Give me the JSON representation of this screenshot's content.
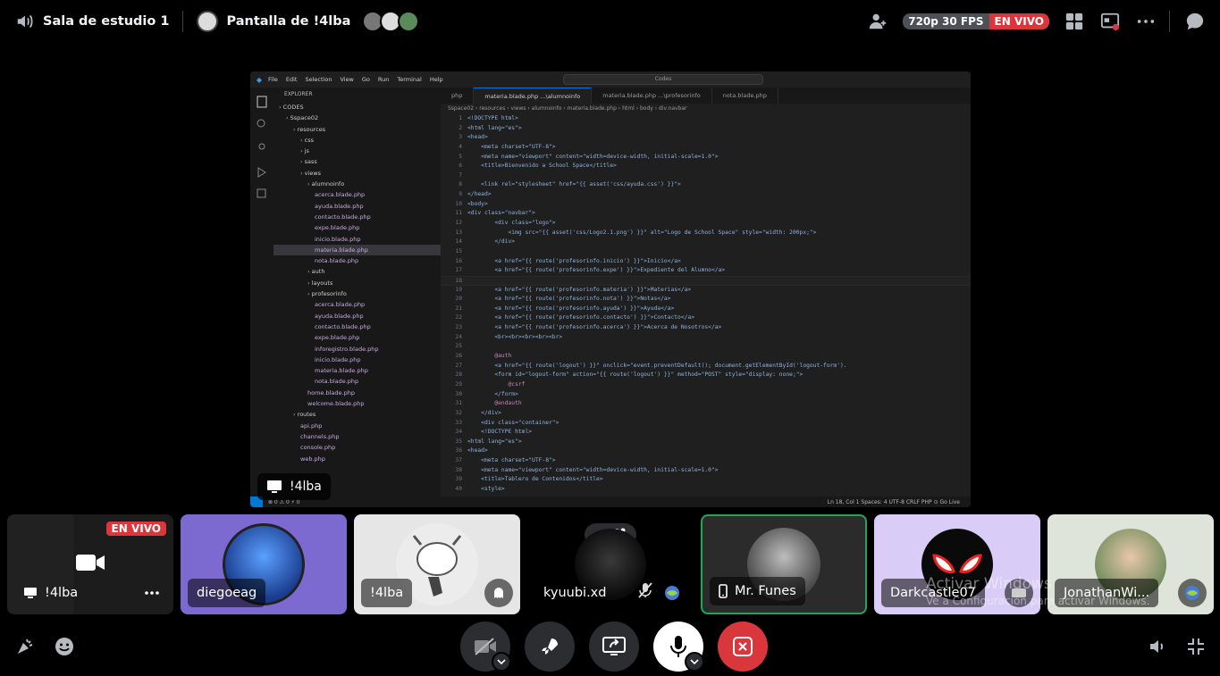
{
  "topbar": {
    "channel_name": "Sala de estudio 1",
    "stream_title": "Pantalla de !4lba",
    "quality": "720p 30 FPS",
    "live": "EN VIVO"
  },
  "stream": {
    "label": "!4lba",
    "vscode": {
      "menu": [
        "File",
        "Edit",
        "Selection",
        "View",
        "Go",
        "Run",
        "Terminal",
        "Help"
      ],
      "search": "Codes",
      "explorer_title": "EXPLORER",
      "tree": [
        {
          "depth": 0,
          "name": "CODES",
          "folder": true
        },
        {
          "depth": 1,
          "name": "Sspace02",
          "folder": true
        },
        {
          "depth": 2,
          "name": "resources",
          "folder": true
        },
        {
          "depth": 3,
          "name": "css",
          "folder": true
        },
        {
          "depth": 3,
          "name": "js",
          "folder": true
        },
        {
          "depth": 3,
          "name": "sass",
          "folder": true
        },
        {
          "depth": 3,
          "name": "views",
          "folder": true
        },
        {
          "depth": 4,
          "name": "alumnoinfo",
          "folder": true
        },
        {
          "depth": 5,
          "name": "acerca.blade.php"
        },
        {
          "depth": 5,
          "name": "ayuda.blade.php"
        },
        {
          "depth": 5,
          "name": "contacto.blade.php"
        },
        {
          "depth": 5,
          "name": "expe.blade.php"
        },
        {
          "depth": 5,
          "name": "inicio.blade.php"
        },
        {
          "depth": 5,
          "name": "materia.blade.php",
          "selected": true
        },
        {
          "depth": 5,
          "name": "nota.blade.php"
        },
        {
          "depth": 4,
          "name": "auth",
          "folder": true
        },
        {
          "depth": 4,
          "name": "layouts",
          "folder": true
        },
        {
          "depth": 4,
          "name": "profesorinfo",
          "folder": true
        },
        {
          "depth": 5,
          "name": "acerca.blade.php"
        },
        {
          "depth": 5,
          "name": "ayuda.blade.php"
        },
        {
          "depth": 5,
          "name": "contacto.blade.php"
        },
        {
          "depth": 5,
          "name": "expe.blade.php"
        },
        {
          "depth": 5,
          "name": "inforegistro.blade.php"
        },
        {
          "depth": 5,
          "name": "inicio.blade.php"
        },
        {
          "depth": 5,
          "name": "materia.blade.php"
        },
        {
          "depth": 5,
          "name": "nota.blade.php"
        },
        {
          "depth": 4,
          "name": "home.blade.php"
        },
        {
          "depth": 4,
          "name": "welcome.blade.php"
        },
        {
          "depth": 2,
          "name": "routes",
          "folder": true
        },
        {
          "depth": 3,
          "name": "api.php"
        },
        {
          "depth": 3,
          "name": "channels.php"
        },
        {
          "depth": 3,
          "name": "console.php"
        },
        {
          "depth": 3,
          "name": "web.php"
        }
      ],
      "tabs": [
        {
          "label": "php",
          "active": false
        },
        {
          "label": "materia.blade.php ...\\alumnoinfo",
          "active": true
        },
        {
          "label": "materia.blade.php ...\\profesorinfo",
          "active": false
        },
        {
          "label": "nota.blade.php",
          "active": false
        }
      ],
      "breadcrumb": "Sspace02 › resources › views › alumnoinfo › materia.blade.php › html › body › div.navbar",
      "code": [
        "<!DOCTYPE html>",
        "<html lang=\"es\">",
        "<head>",
        "    <meta charset=\"UTF-8\">",
        "    <meta name=\"viewport\" content=\"width=device-width, initial-scale=1.0\">",
        "    <title>Bienvenido a School Space</title>",
        "",
        "    <link rel=\"stylesheet\" href=\"{{ asset('css/ayuda.css') }}\">",
        "</head>",
        "<body>",
        "<div class=\"navbar\">",
        "        <div class=\"logo\">",
        "            <img src=\"{{ asset('css/Logo2.1.png') }}\" alt=\"Logo de School Space\" style=\"width: 200px;\">",
        "        </div>",
        "",
        "        <a href=\"{{ route('profesorinfo.inicio') }}\">Inicio</a>",
        "        <a href=\"{{ route('profesorinfo.expe') }}\">Expediente del Alumno</a>",
        "",
        "        <a href=\"{{ route('profesorinfo.materia') }}\">Materias</a>",
        "        <a href=\"{{ route('profesorinfo.nota') }}\">Notas</a>",
        "        <a href=\"{{ route('profesorinfo.ayuda') }}\">Ayuda</a>",
        "        <a href=\"{{ route('profesorinfo.contacto') }}\">Contacto</a>",
        "        <a href=\"{{ route('profesorinfo.acerca') }}\">Acerca de Nosotros</a>",
        "        <br><br><br><br><br>",
        "",
        "        @auth",
        "        <a href=\"{{ route('logout') }}\" onclick=\"event.preventDefault(); document.getElementById('logout-form').",
        "        <form id=\"logout-form\" action=\"{{ route('logout') }}\" method=\"POST\" style=\"display: none;\">",
        "            @csrf",
        "        </form>",
        "        @endauth",
        "    </div>",
        "    <div class=\"container\">",
        "    <!DOCTYPE html>",
        "<html lang=\"es\">",
        "<head>",
        "    <meta charset=\"UTF-8\">",
        "    <meta name=\"viewport\" content=\"width=device-width, initial-scale=1.0\">",
        "    <title>Tablero de Contenidos</title>",
        "    <style>"
      ],
      "current_line": 18,
      "status_left": "⊗ 0 ⚠ 0   ⚡ 0",
      "status_right": "Ln 18, Col 1   Spaces: 4   UTF-8   CRLF   PHP   ⊙ Go Live"
    }
  },
  "tiles": [
    {
      "name": "!4lba",
      "live": "EN VIVO",
      "kind": "stream"
    },
    {
      "name": "diegoeag",
      "kind": "avatar",
      "color": "#2a6fdb"
    },
    {
      "name": "!4lba",
      "kind": "avatar-light"
    },
    {
      "name": "kyuubi.xd",
      "kind": "dark"
    },
    {
      "name": "Mr. Funes",
      "kind": "speaking"
    },
    {
      "name": "Darkcastle07",
      "kind": "avatar-purple"
    },
    {
      "name": "JonathanWi...",
      "kind": "photo"
    }
  ],
  "watermark": {
    "line1": "Activar Windows",
    "line2": "Ve a Configuración para activar Windows."
  },
  "colors": {
    "live": "#da373c",
    "speaking": "#23a559",
    "leave": "#da373c",
    "button_bg": "#2b2d31"
  }
}
